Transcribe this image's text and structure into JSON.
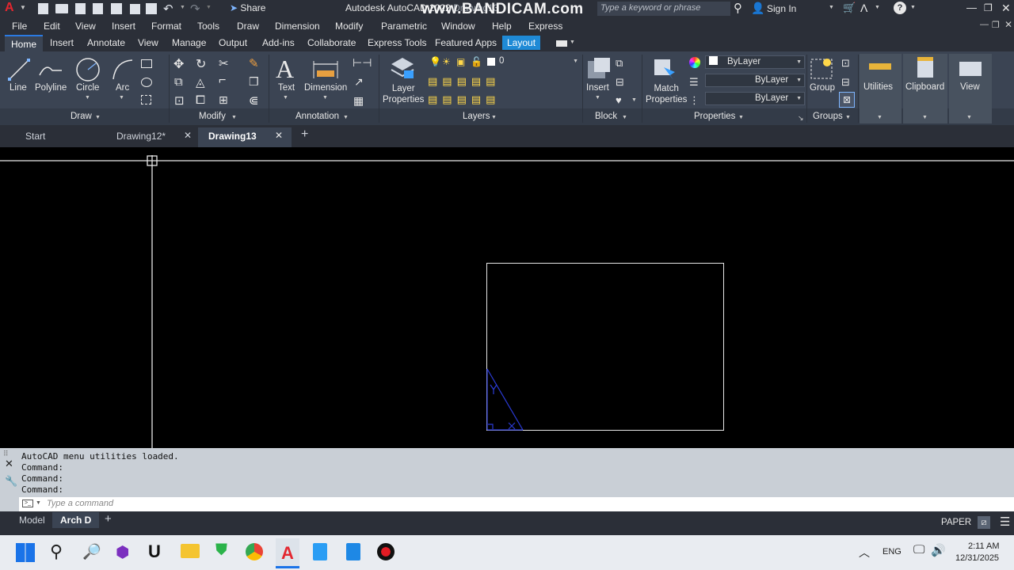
{
  "app": {
    "title": "Autodesk AutoCAD 2022",
    "title_suffix": "Drawing13",
    "watermark": "www.BANDICAM.com",
    "search_placeholder": "Type a keyword or phrase",
    "share": "Share",
    "sign_in": "Sign In"
  },
  "menu": [
    "File",
    "Edit",
    "View",
    "Insert",
    "Format",
    "Tools",
    "Draw",
    "Dimension",
    "Modify",
    "Parametric",
    "Window",
    "Help",
    "Express"
  ],
  "ribbon_tabs": [
    "Home",
    "Insert",
    "Annotate",
    "View",
    "Manage",
    "Output",
    "Add-ins",
    "Collaborate",
    "Express Tools",
    "Featured Apps",
    "Layout"
  ],
  "active_tab": "Home",
  "highlight_tab": "Layout",
  "ribbon": {
    "draw": {
      "title": "Draw",
      "tools": [
        "Line",
        "Polyline",
        "Circle",
        "Arc"
      ]
    },
    "modify": {
      "title": "Modify"
    },
    "annotation": {
      "title": "Annotation",
      "tools": [
        "Text",
        "Dimension"
      ]
    },
    "layers": {
      "title": "Layers",
      "layer_props": "Layer\nProperties",
      "current_layer": "0"
    },
    "block": {
      "title": "Block",
      "insert": "Insert"
    },
    "properties": {
      "title": "Properties",
      "match": "Match\nProperties",
      "color": "ByLayer",
      "linetype": "ByLayer",
      "lineweight": "ByLayer"
    },
    "groups": {
      "title": "Groups",
      "group": "Group"
    },
    "utilities": "Utilities",
    "clipboard": "Clipboard",
    "view": "View"
  },
  "file_tabs": {
    "start": "Start",
    "tabs": [
      {
        "label": "Drawing12*",
        "active": false
      },
      {
        "label": "Drawing13",
        "active": true
      }
    ]
  },
  "command": {
    "history": [
      "AutoCAD menu utilities loaded.",
      "Command:",
      "Command:",
      "Command:"
    ],
    "placeholder": "Type a command"
  },
  "layout_tabs": {
    "model": "Model",
    "active": "Arch D",
    "space": "PAPER"
  },
  "taskbar": {
    "lang": "ENG",
    "time": "2:11 AM",
    "date": "12/31/2025"
  },
  "colors": {
    "accent": "#1f8ad6",
    "ribbon": "#3b4453",
    "dark": "#2b2f38",
    "hatch": "#2b3bd6"
  }
}
